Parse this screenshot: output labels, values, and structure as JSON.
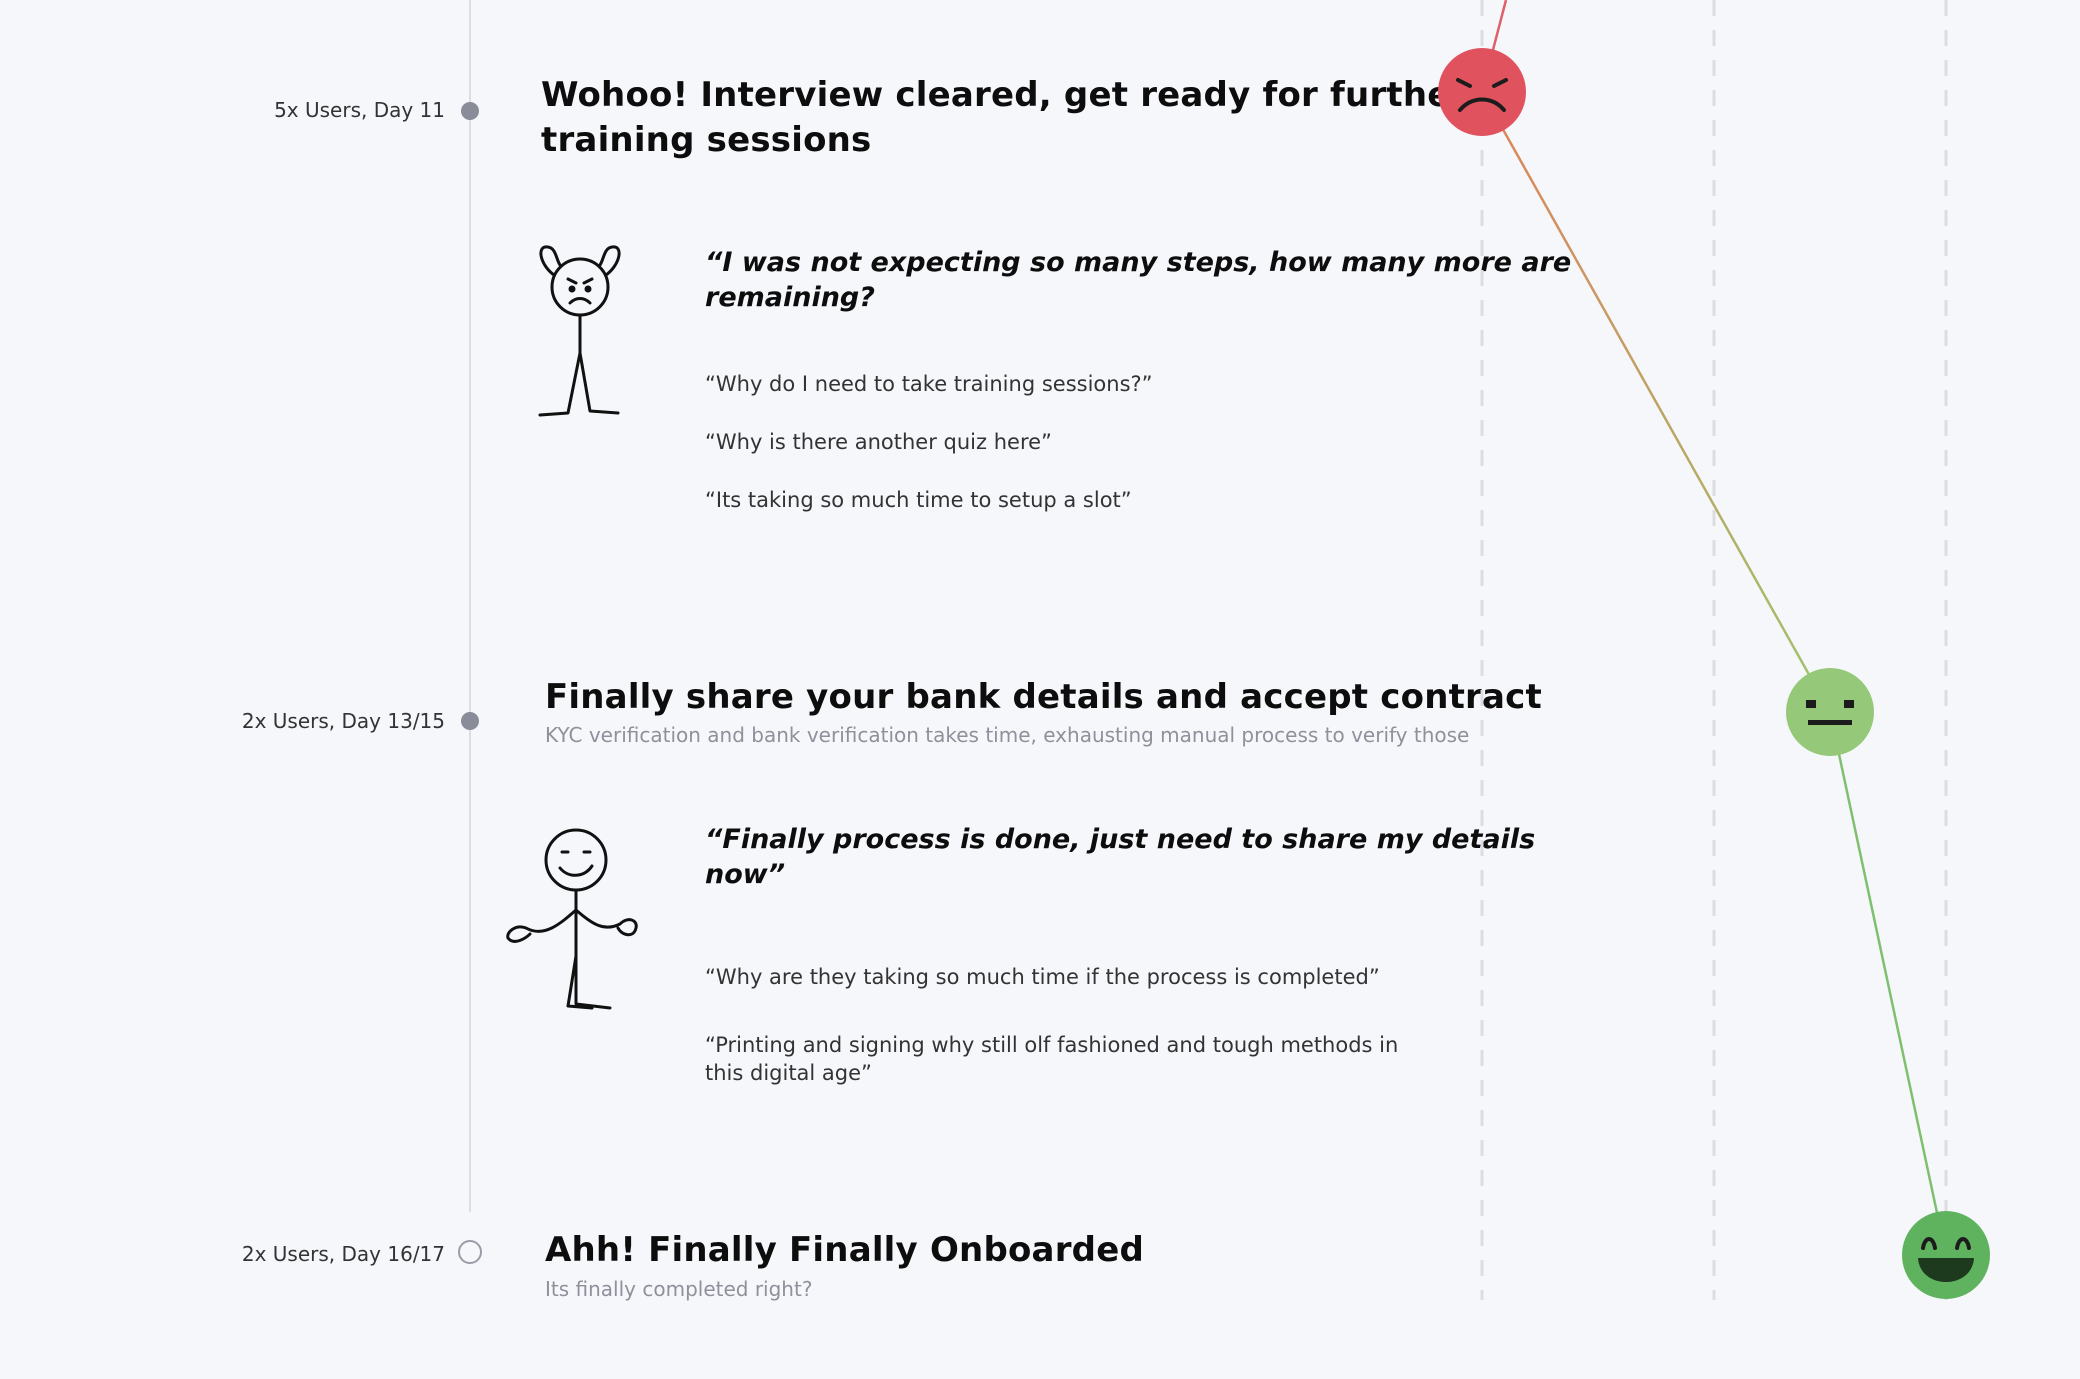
{
  "stages": [
    {
      "label": "5x Users, Day 11",
      "title_line1": "Wohoo! Interview cleared, get ready for further",
      "title_line2": "training sessions",
      "quote_line1": "“I was not expecting so many steps, how many more are",
      "quote_line2": "remaining?",
      "comments": [
        "“Why do I need to take training sessions?”",
        "“Why is there another quiz here”",
        "“Its taking so much time to setup a slot”"
      ],
      "emotion": "sad",
      "illustration": "frustrated-stick-figure"
    },
    {
      "label": "2x Users, Day 13/15",
      "title": "Finally share your bank details and accept contract",
      "subtitle": "KYC verification and bank verification takes time, exhausting manual process to verify those",
      "quote_line1": "“Finally process is done, just need to share my details",
      "quote_line2": "now”",
      "comments": [
        "“Why are they taking so much time if the process is completed”",
        "“Printing and signing why still olf fashioned and tough methods in",
        "this digital age”"
      ],
      "emotion": "neutral",
      "illustration": "shrugging-stick-figure"
    },
    {
      "label": "2x Users, Day 16/17",
      "title": "Ahh! Finally Finally Onboarded",
      "subtitle": "Its finally completed right?",
      "emotion": "happy"
    }
  ],
  "colors": {
    "sad": "#e0525e",
    "neutral": "#96c87a",
    "happy": "#5fb35f",
    "line_sad_to_neutral_start": "#e0825a",
    "line_neutral_to_happy": "#7fc06f"
  }
}
